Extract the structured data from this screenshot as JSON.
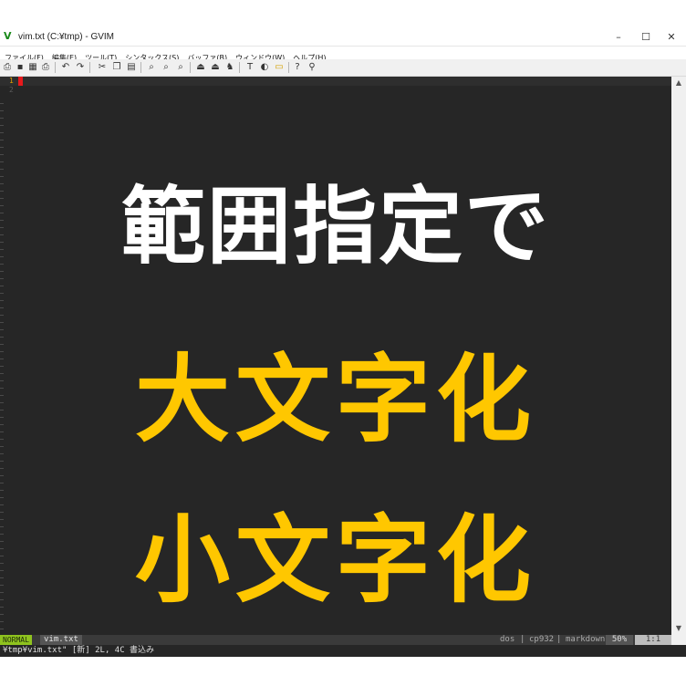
{
  "window": {
    "title": "vim.txt (C:¥tmp) - GVIM",
    "app_icon": "vim-icon",
    "controls": [
      "–",
      "☐",
      "✕"
    ]
  },
  "menubar": {
    "items": [
      {
        "label": "ファイル(F)"
      },
      {
        "label": "編集(E)"
      },
      {
        "label": "ツール(T)"
      },
      {
        "label": "シンタックス(S)"
      },
      {
        "label": "バッファ(B)"
      },
      {
        "label": "ウィンドウ(W)"
      },
      {
        "label": "ヘルプ(H)"
      }
    ]
  },
  "toolbar": {
    "icons": [
      {
        "name": "open-icon",
        "glyph": "⎙"
      },
      {
        "name": "save-icon",
        "glyph": "▪"
      },
      {
        "name": "save-all-icon",
        "glyph": "▦"
      },
      {
        "name": "print-icon",
        "glyph": "⎙"
      },
      {
        "name": "undo-icon",
        "glyph": "↶"
      },
      {
        "name": "redo-icon",
        "glyph": "↷"
      },
      {
        "name": "cut-icon",
        "glyph": "✂"
      },
      {
        "name": "copy-icon",
        "glyph": "❐"
      },
      {
        "name": "paste-icon",
        "glyph": "▤"
      },
      {
        "name": "find-icon",
        "glyph": "⌕"
      },
      {
        "name": "find-next-icon",
        "glyph": "⌕"
      },
      {
        "name": "find-prev-icon",
        "glyph": "⌕"
      },
      {
        "name": "load-session-icon",
        "glyph": "⏏"
      },
      {
        "name": "save-session-icon",
        "glyph": "⏏"
      },
      {
        "name": "run-script-icon",
        "glyph": "♞"
      },
      {
        "name": "make-icon",
        "glyph": "T"
      },
      {
        "name": "shell-icon",
        "glyph": "◐"
      },
      {
        "name": "tag-icon",
        "glyph": "▭"
      },
      {
        "name": "help-icon",
        "glyph": "?"
      },
      {
        "name": "find-help-icon",
        "glyph": "⚲"
      }
    ]
  },
  "editor": {
    "line_numbers": [
      "1",
      "2"
    ],
    "line1": "範囲指定で",
    "line2": "大文字化",
    "line3": "小文字化",
    "colors": {
      "white": "#ffffff",
      "yellow": "#ffc700",
      "background": "#262626"
    }
  },
  "statusline": {
    "mode": "NORMAL",
    "filename": "vim.txt",
    "fileformat": "dos",
    "encoding": "cp932",
    "filetype": "markdown",
    "percent": "50%",
    "position": "1:1"
  },
  "cmdline": {
    "text": "¥tmp¥vim.txt\" [新] 2L, 4C 書込み"
  }
}
